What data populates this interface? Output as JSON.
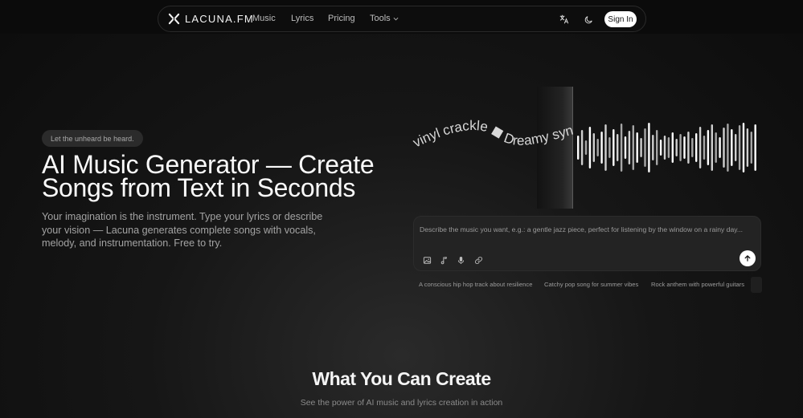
{
  "header": {
    "brand": "LACUNA.FM",
    "nav": {
      "music": "Music",
      "lyrics": "Lyrics",
      "pricing": "Pricing",
      "tools": "Tools"
    },
    "sign_in_label": "Sign In",
    "icons": [
      "lacuna-logo",
      "translate-icon",
      "moon-icon",
      "chevron-down-icon"
    ]
  },
  "hero": {
    "badge": "Let the unheard be heard.",
    "title": "AI Music Generator — Create Songs from Text in Seconds",
    "subtitle": "Your imagination is the instrument. Type your lyrics or describe your vision — Lacuna generates complete songs with vocals, melody, and instrumentation. Free to try."
  },
  "visual": {
    "curved_text": "vinyl crackle ◼ Dreamy syn"
  },
  "prompt": {
    "placeholder": "Describe the music you want, e.g.: a gentle jazz piece, perfect for listening by the window on a rainy day...",
    "value": "",
    "tools": [
      "image-icon",
      "music-note-icon",
      "microphone-icon",
      "link-icon"
    ],
    "send_icon": "arrow-up-icon"
  },
  "suggestions": [
    "A conscious hip hop track about resilience",
    "Catchy pop song for summer vibes",
    "Rock anthem with powerful guitars"
  ],
  "section": {
    "title": "What You Can Create",
    "subtitle": "See the power of AI music and lyrics creation in action"
  }
}
